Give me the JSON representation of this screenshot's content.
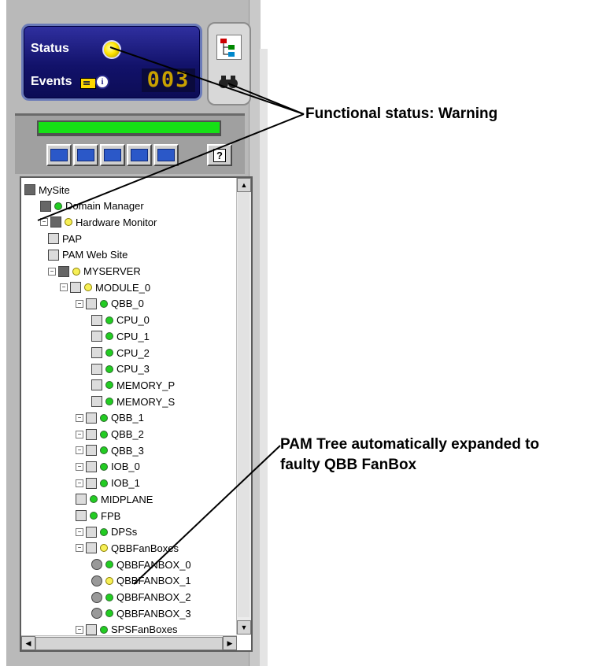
{
  "status_panel": {
    "status_label": "Status",
    "events_label": "Events",
    "events_count": "003",
    "status_color": "#ffe500"
  },
  "toolbar": {
    "progress_percent": 100,
    "progress_color": "#15e015",
    "help_label": "?"
  },
  "tree": {
    "rows": [
      {
        "label": "MySite",
        "status": null
      },
      {
        "label": "Domain Manager",
        "status": "ok"
      },
      {
        "label": "Hardware Monitor",
        "status": "warn"
      },
      {
        "label": "PAP",
        "status": null
      },
      {
        "label": "PAM Web Site",
        "status": null
      },
      {
        "label": "MYSERVER",
        "status": "warn"
      },
      {
        "label": "MODULE_0",
        "status": "warn"
      },
      {
        "label": "QBB_0",
        "status": "ok"
      },
      {
        "label": "CPU_0",
        "status": "ok"
      },
      {
        "label": "CPU_1",
        "status": "ok"
      },
      {
        "label": "CPU_2",
        "status": "ok"
      },
      {
        "label": "CPU_3",
        "status": "ok"
      },
      {
        "label": "MEMORY_P",
        "status": "ok"
      },
      {
        "label": "MEMORY_S",
        "status": "ok"
      },
      {
        "label": "QBB_1",
        "status": "ok"
      },
      {
        "label": "QBB_2",
        "status": "ok"
      },
      {
        "label": "QBB_3",
        "status": "ok"
      },
      {
        "label": "IOB_0",
        "status": "ok"
      },
      {
        "label": "IOB_1",
        "status": "ok"
      },
      {
        "label": "MIDPLANE",
        "status": "ok"
      },
      {
        "label": "FPB",
        "status": "ok"
      },
      {
        "label": "DPSs",
        "status": "ok"
      },
      {
        "label": "QBBFanBoxes",
        "status": "warn"
      },
      {
        "label": "QBBFANBOX_0",
        "status": "ok"
      },
      {
        "label": "QBBFANBOX_1",
        "status": "warn"
      },
      {
        "label": "QBBFANBOX_2",
        "status": "ok"
      },
      {
        "label": "QBBFANBOX_3",
        "status": "ok"
      },
      {
        "label": "SPSFanBoxes",
        "status": "ok"
      }
    ]
  },
  "annotations": {
    "functional_status": "Functional status: Warning",
    "pam_tree_line1": "PAM Tree automatically expanded to",
    "pam_tree_line2": "faulty QBB FanBox"
  }
}
